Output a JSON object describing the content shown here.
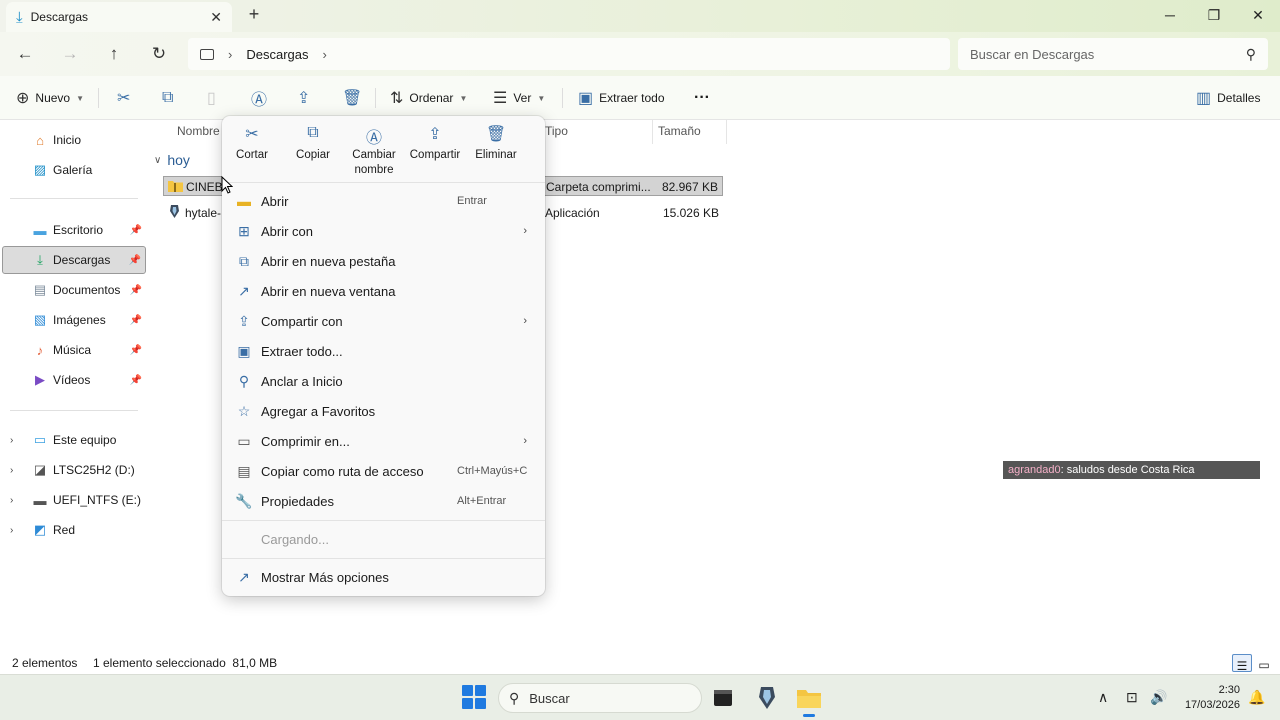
{
  "window": {
    "tab_title": "Descargas",
    "tab_icon": "download-icon"
  },
  "address": {
    "crumb": "Descargas",
    "search_placeholder": "Buscar en Descargas"
  },
  "toolbar": {
    "new_label": "Nuevo",
    "sort_label": "Ordenar",
    "view_label": "Ver",
    "extract_label": "Extraer todo",
    "more_label": "···",
    "details_label": "Detalles"
  },
  "sidebar": {
    "items": [
      {
        "label": "Inicio",
        "icon": "home-icon"
      },
      {
        "label": "Galería",
        "icon": "gallery-icon"
      },
      {
        "label": "Escritorio",
        "icon": "desktop-icon"
      },
      {
        "label": "Descargas",
        "icon": "download-icon"
      },
      {
        "label": "Documentos",
        "icon": "documents-icon"
      },
      {
        "label": "Imágenes",
        "icon": "pictures-icon"
      },
      {
        "label": "Música",
        "icon": "music-icon"
      },
      {
        "label": "Vídeos",
        "icon": "videos-icon"
      },
      {
        "label": "Este equipo",
        "icon": "pc-icon"
      },
      {
        "label": "LTSC25H2 (D:)",
        "icon": "drive-icon"
      },
      {
        "label": "UEFI_NTFS (E:)",
        "icon": "drive-icon"
      },
      {
        "label": "Red",
        "icon": "network-icon"
      }
    ]
  },
  "filelist": {
    "columns": {
      "name": "Nombre",
      "type": "Tipo",
      "size": "Tamaño"
    },
    "group": "hoy",
    "rows": [
      {
        "name": "CINEBE",
        "type": "Carpeta comprimi...",
        "size": "82.967 KB",
        "icon": "zip-folder-icon"
      },
      {
        "name": "hytale-",
        "type": "Aplicación",
        "size": "15.026 KB",
        "icon": "app-icon"
      }
    ]
  },
  "context_menu": {
    "quick": [
      {
        "label": "Cortar",
        "icon": "cut-icon"
      },
      {
        "label": "Copiar",
        "icon": "copy-icon"
      },
      {
        "label": "Cambiar\nnombre",
        "icon": "rename-icon"
      },
      {
        "label": "Compartir",
        "icon": "share-icon"
      },
      {
        "label": "Eliminar",
        "icon": "delete-icon"
      }
    ],
    "items": [
      {
        "label": "Abrir",
        "accel": "Entrar",
        "icon": "open-icon"
      },
      {
        "label": "Abrir con",
        "icon": "open-with-icon",
        "submenu": true
      },
      {
        "label": "Abrir en nueva pestaña",
        "icon": "new-tab-icon"
      },
      {
        "label": "Abrir en nueva ventana",
        "icon": "new-window-icon"
      },
      {
        "label": "Compartir con",
        "icon": "share-with-icon",
        "submenu": true
      },
      {
        "label": "Extraer todo...",
        "icon": "extract-icon"
      },
      {
        "label": "Anclar a Inicio",
        "icon": "pin-icon"
      },
      {
        "label": "Agregar a Favoritos",
        "icon": "star-icon"
      },
      {
        "label": "Comprimir en...",
        "icon": "compress-icon",
        "submenu": true
      },
      {
        "label": "Copiar como ruta de acceso",
        "accel": "Ctrl+Mayús+C",
        "icon": "copy-path-icon"
      },
      {
        "label": "Propiedades",
        "accel": "Alt+Entrar",
        "icon": "properties-icon"
      }
    ],
    "loading": "Cargando...",
    "more_options": "Mostrar Más opciones"
  },
  "chat": {
    "user": "agrandad0",
    "message": " : saludos desde Costa Rica"
  },
  "status": {
    "count": "2 elementos",
    "selection": "1 elemento seleccionado  81,0 MB"
  },
  "taskbar": {
    "search_placeholder": "Buscar",
    "time": "2:30",
    "date": "17/03/2026"
  },
  "colors": {
    "accent": "#1f7ae0",
    "folder": "#f4c542",
    "selection": "#d3d3d3"
  }
}
